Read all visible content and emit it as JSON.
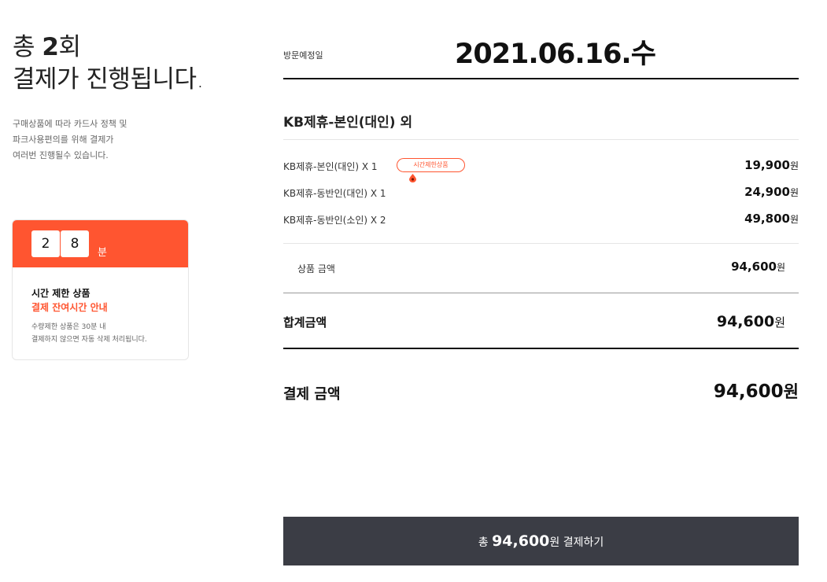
{
  "summary": {
    "prefix": "총",
    "count": "2",
    "count_suffix": "회",
    "line2": "결제가 진행됩니다.",
    "notice_lines": [
      "구매상품에 따라 카드사 정책 및",
      "파크사용편의를 위해 결제가",
      "여러번 진행될수 있습니다."
    ]
  },
  "timer": {
    "digit1": "2",
    "digit2": "8",
    "unit": "분",
    "title": "시간 제한 상품",
    "subtitle": "결제 잔여시간 안내",
    "desc_lines": [
      "수량제한 상품은 30분 내",
      "결제하지 않으면 자동 삭제 처리됩니다."
    ],
    "accent_color": "#ff5530"
  },
  "visit": {
    "label": "방문예정일",
    "date": "2021.06.16.수"
  },
  "product_title": "KB제휴-본인(대인) 외",
  "items": [
    {
      "name": "KB제휴-본인(대인) X 1",
      "price": "19,900",
      "unit": "원",
      "badge": "시간제한상품"
    },
    {
      "name": "KB제휴-동반인(대인) X 1",
      "price": "24,900",
      "unit": "원"
    },
    {
      "name": "KB제휴-동반인(소인) X 2",
      "price": "49,800",
      "unit": "원"
    }
  ],
  "subtotal": {
    "label": "상품 금액",
    "price": "94,600",
    "unit": "원"
  },
  "total": {
    "label": "합계금액",
    "price": "94,600",
    "unit": "원"
  },
  "payment": {
    "label": "결제 금액",
    "price": "94,600",
    "unit": "원"
  },
  "pay_button": {
    "prefix": "총",
    "amount": "94,600",
    "unit": "원",
    "action": "결제하기",
    "bg_color": "#3b3d45"
  }
}
